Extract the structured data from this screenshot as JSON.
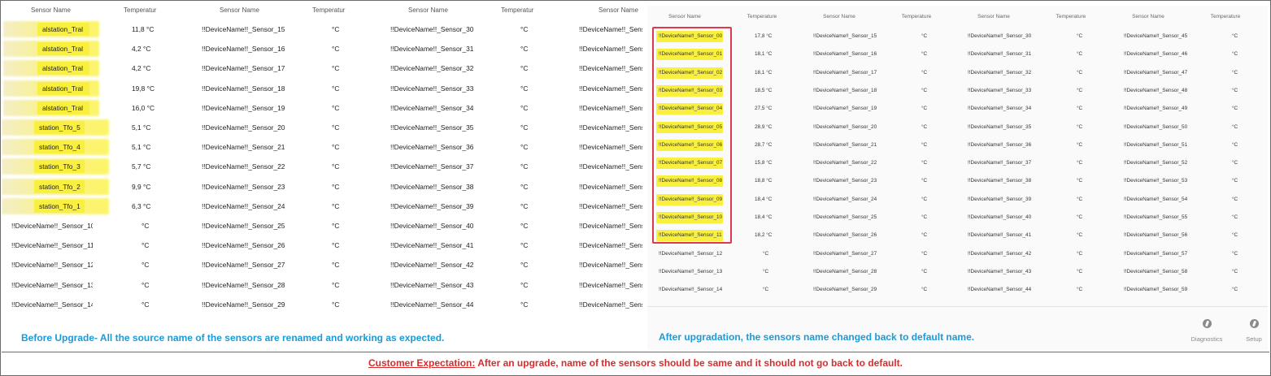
{
  "left": {
    "headers": [
      "Sensor Name",
      "Temperatur",
      "Sensor Name",
      "Temperatur",
      "Sensor Name",
      "Temperatur",
      "Sensor Name"
    ],
    "col1_names": [
      "alstation_Tral",
      "alstation_Tral",
      "alstation_Tral",
      "alstation_Tral",
      "alstation_Tral",
      "station_Tfo_5",
      "station_Tfo_4",
      "station_Tfo_3",
      "station_Tfo_2",
      "station_Tfo_1",
      "!!DeviceName!!_Sensor_10",
      "!!DeviceName!!_Sensor_11",
      "!!DeviceName!!_Sensor_12",
      "!!DeviceName!!_Sensor_13",
      "!!DeviceName!!_Sensor_14"
    ],
    "col1_temps": [
      "11,8 °C",
      "4,2 °C",
      "4,2 °C",
      "19,8 °C",
      "16,0 °C",
      "5,1 °C",
      "5,1 °C",
      "5,7 °C",
      "9,9 °C",
      "6,3 °C",
      "°C",
      "°C",
      "°C",
      "°C",
      "°C"
    ],
    "col2_names": [
      "!!DeviceName!!_Sensor_15",
      "!!DeviceName!!_Sensor_16",
      "!!DeviceName!!_Sensor_17",
      "!!DeviceName!!_Sensor_18",
      "!!DeviceName!!_Sensor_19",
      "!!DeviceName!!_Sensor_20",
      "!!DeviceName!!_Sensor_21",
      "!!DeviceName!!_Sensor_22",
      "!!DeviceName!!_Sensor_23",
      "!!DeviceName!!_Sensor_24",
      "!!DeviceName!!_Sensor_25",
      "!!DeviceName!!_Sensor_26",
      "!!DeviceName!!_Sensor_27",
      "!!DeviceName!!_Sensor_28",
      "!!DeviceName!!_Sensor_29"
    ],
    "col3_names": [
      "!!DeviceName!!_Sensor_30",
      "!!DeviceName!!_Sensor_31",
      "!!DeviceName!!_Sensor_32",
      "!!DeviceName!!_Sensor_33",
      "!!DeviceName!!_Sensor_34",
      "!!DeviceName!!_Sensor_35",
      "!!DeviceName!!_Sensor_36",
      "!!DeviceName!!_Sensor_37",
      "!!DeviceName!!_Sensor_38",
      "!!DeviceName!!_Sensor_39",
      "!!DeviceName!!_Sensor_40",
      "!!DeviceName!!_Sensor_41",
      "!!DeviceName!!_Sensor_42",
      "!!DeviceName!!_Sensor_43",
      "!!DeviceName!!_Sensor_44"
    ],
    "empty_temp": "°C",
    "col4_name": "!!DeviceName!!_Sens",
    "caption": "Before Upgrade- All the source name of the sensors are renamed and working as expected."
  },
  "right": {
    "headers": [
      "Sensor Name",
      "Temperature",
      "Sensor Name",
      "Temperature",
      "Sensor Name",
      "Temperature",
      "Sensor Name",
      "Temperature"
    ],
    "col1_names": [
      "!!DeviceName!!_Sensor_00",
      "!!DeviceName!!_Sensor_01",
      "!!DeviceName!!_Sensor_02",
      "!!DeviceName!!_Sensor_03",
      "!!DeviceName!!_Sensor_04",
      "!!DeviceName!!_Sensor_05",
      "!!DeviceName!!_Sensor_06",
      "!!DeviceName!!_Sensor_07",
      "!!DeviceName!!_Sensor_08",
      "!!DeviceName!!_Sensor_09",
      "!!DeviceName!!_Sensor_10",
      "!!DeviceName!!_Sensor_11",
      "!!DeviceName!!_Sensor_12",
      "!!DeviceName!!_Sensor_13",
      "!!DeviceName!!_Sensor_14"
    ],
    "col1_temps": [
      "17,8 °C",
      "18,1 °C",
      "18,1 °C",
      "18,5 °C",
      "27,5 °C",
      "28,9 °C",
      "28,7 °C",
      "15,8 °C",
      "18,8 °C",
      "18,4 °C",
      "18,4 °C",
      "18,2 °C",
      "°C",
      "°C",
      "°C"
    ],
    "col2_names": [
      "!!DeviceName!!_Sensor_15",
      "!!DeviceName!!_Sensor_16",
      "!!DeviceName!!_Sensor_17",
      "!!DeviceName!!_Sensor_18",
      "!!DeviceName!!_Sensor_19",
      "!!DeviceName!!_Sensor_20",
      "!!DeviceName!!_Sensor_21",
      "!!DeviceName!!_Sensor_22",
      "!!DeviceName!!_Sensor_23",
      "!!DeviceName!!_Sensor_24",
      "!!DeviceName!!_Sensor_25",
      "!!DeviceName!!_Sensor_26",
      "!!DeviceName!!_Sensor_27",
      "!!DeviceName!!_Sensor_28",
      "!!DeviceName!!_Sensor_29"
    ],
    "col3_names": [
      "!!DeviceName!!_Sensor_30",
      "!!DeviceName!!_Sensor_31",
      "!!DeviceName!!_Sensor_32",
      "!!DeviceName!!_Sensor_33",
      "!!DeviceName!!_Sensor_34",
      "!!DeviceName!!_Sensor_35",
      "!!DeviceName!!_Sensor_36",
      "!!DeviceName!!_Sensor_37",
      "!!DeviceName!!_Sensor_38",
      "!!DeviceName!!_Sensor_39",
      "!!DeviceName!!_Sensor_40",
      "!!DeviceName!!_Sensor_41",
      "!!DeviceName!!_Sensor_42",
      "!!DeviceName!!_Sensor_43",
      "!!DeviceName!!_Sensor_44"
    ],
    "col4_names": [
      "!!DeviceName!!_Sensor_45",
      "!!DeviceName!!_Sensor_46",
      "!!DeviceName!!_Sensor_47",
      "!!DeviceName!!_Sensor_48",
      "!!DeviceName!!_Sensor_49",
      "!!DeviceName!!_Sensor_50",
      "!!DeviceName!!_Sensor_51",
      "!!DeviceName!!_Sensor_52",
      "!!DeviceName!!_Sensor_53",
      "!!DeviceName!!_Sensor_54",
      "!!DeviceName!!_Sensor_55",
      "!!DeviceName!!_Sensor_56",
      "!!DeviceName!!_Sensor_57",
      "!!DeviceName!!_Sensor_58",
      "!!DeviceName!!_Sensor_59"
    ],
    "empty_temp": "°C",
    "caption": "After upgradation, the sensors name changed back to default name.",
    "nav": [
      {
        "label": "Diagnostics",
        "icon": "diagnostics-icon"
      },
      {
        "label": "Setup",
        "icon": "setup-icon"
      }
    ]
  },
  "footer": {
    "label": "Customer Expectation:",
    "text": " After an upgrade, name of the sensors should be same and it should not go back to default."
  },
  "colors": {
    "caption_blue": "#1a9bd7",
    "expectation_red": "#d42d2d",
    "highlight_yellow": "#f9ef3e",
    "red_box": "#e0384a"
  }
}
